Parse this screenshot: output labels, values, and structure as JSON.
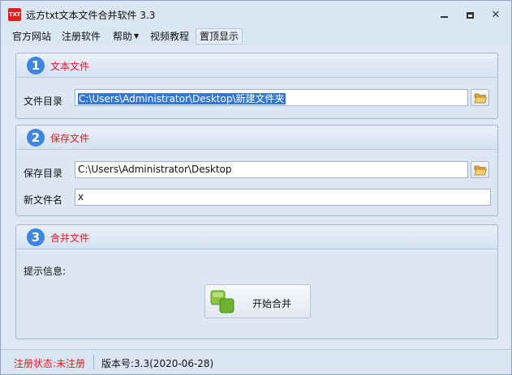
{
  "window": {
    "title": "远方txt文本文件合并软件 3.3",
    "icon_text": "TXT"
  },
  "menu": {
    "items": [
      {
        "label": "官方网站"
      },
      {
        "label": "注册软件"
      },
      {
        "label": "帮助",
        "has_arrow": true
      },
      {
        "label": "视频教程"
      },
      {
        "label": "置顶显示",
        "active": true
      }
    ]
  },
  "section1": {
    "number": "1",
    "title": "文本文件",
    "dir_label": "文件目录",
    "dir_value": "C:\\Users\\Administrator\\Desktop\\新建文件夹",
    "dir_value_selected": true
  },
  "section2": {
    "number": "2",
    "title": "保存文件",
    "dir_label": "保存目录",
    "dir_value": "C:\\Users\\Administrator\\Desktop",
    "name_label": "新文件名",
    "name_value": "x"
  },
  "section3": {
    "number": "3",
    "title": "合并文件",
    "info_label": "提示信息:",
    "merge_button": "开始合并"
  },
  "status": {
    "registration": "注册状态:未注册",
    "version": "版本号:3.3(2020-06-28)"
  },
  "colors": {
    "accent_red": "#e01d1d",
    "step_blue": "#3f86e0",
    "selection_blue": "#3378d6"
  }
}
